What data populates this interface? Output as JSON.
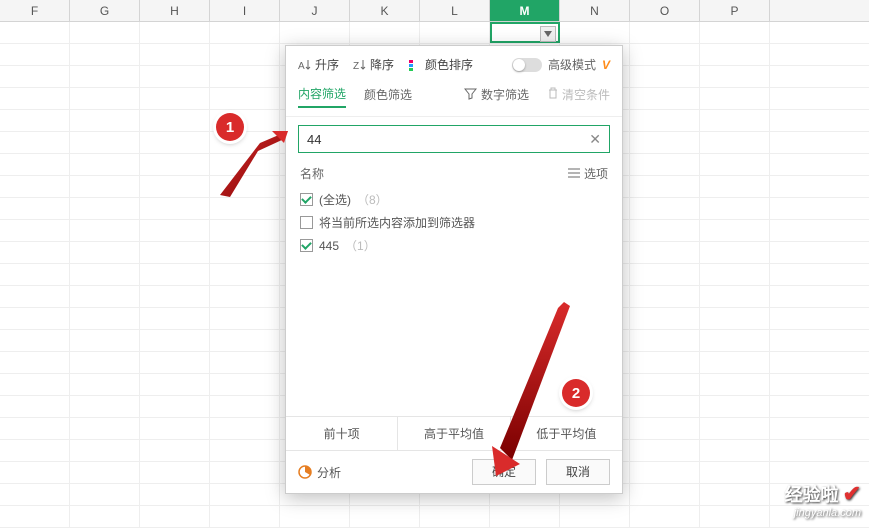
{
  "columns": [
    "F",
    "G",
    "H",
    "I",
    "J",
    "K",
    "L",
    "M",
    "N",
    "O",
    "P"
  ],
  "active_col_index": 7,
  "popup": {
    "sort_asc": "升序",
    "sort_desc": "降序",
    "sort_color": "颜色排序",
    "adv_mode": "高级模式",
    "adv_v": "V",
    "tab_content": "内容筛选",
    "tab_color": "颜色筛选",
    "num_filter": "数字筛选",
    "clear_cond": "清空条件",
    "search_value": "44",
    "name_label": "名称",
    "options_label": "选项",
    "items": [
      {
        "checked": true,
        "label": "(全选)",
        "count": "（8）"
      },
      {
        "checked": false,
        "label": "将当前所选内容添加到筛选器",
        "count": ""
      },
      {
        "checked": true,
        "label": "445",
        "count": "（1）"
      }
    ],
    "btn_top10": "前十项",
    "btn_above": "高于平均值",
    "btn_below": "低于平均值",
    "analyze": "分析",
    "ok": "确定",
    "cancel": "取消"
  },
  "callouts": {
    "one": "1",
    "two": "2"
  },
  "watermark": {
    "brand": "经验啦",
    "url": "jingyanla.com"
  }
}
